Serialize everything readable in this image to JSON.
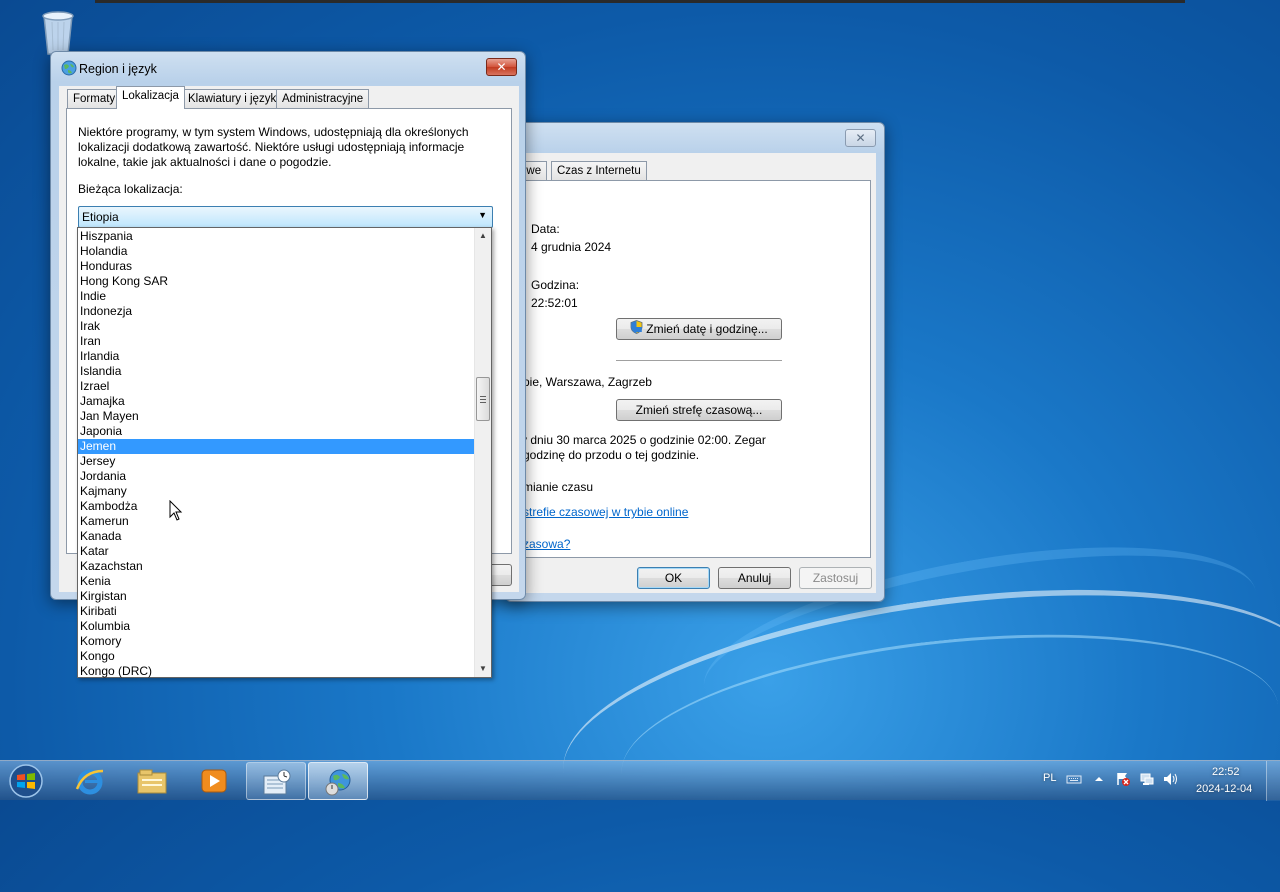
{
  "region_dialog": {
    "title": "Region i język",
    "tabs": [
      {
        "label": "Formaty"
      },
      {
        "label": "Lokalizacja"
      },
      {
        "label": "Klawiatury i języki"
      },
      {
        "label": "Administracyjne"
      }
    ],
    "description": "Niektóre programy, w tym system Windows, udostępniają dla określonych lokalizacji dodatkową zawartość. Niektóre usługi udostępniają informacje lokalne, takie jak aktualności i dane o pogodzie.",
    "current_location_label": "Bieżąca lokalizacja:",
    "current_location_value": "Etiopia",
    "dropdown_items": [
      "Hiszpania",
      "Holandia",
      "Honduras",
      "Hong Kong SAR",
      "Indie",
      "Indonezja",
      "Irak",
      "Iran",
      "Irlandia",
      "Islandia",
      "Izrael",
      "Jamajka",
      "Jan Mayen",
      "Japonia",
      "Jemen",
      "Jersey",
      "Jordania",
      "Kajmany",
      "Kambodża",
      "Kamerun",
      "Kanada",
      "Katar",
      "Kazachstan",
      "Kenia",
      "Kirgistan",
      "Kiribati",
      "Kolumbia",
      "Komory",
      "Kongo",
      "Kongo (DRC)"
    ],
    "highlighted_item": "Jemen"
  },
  "datetime_dialog": {
    "tabs": [
      {
        "label": "owe"
      },
      {
        "label": "Czas z Internetu"
      }
    ],
    "date_label": "Data:",
    "date_value": "4 grudnia 2024",
    "time_label": "Godzina:",
    "time_value": "22:52:01",
    "change_datetime_button": "Zmień datę i godzinę...",
    "timezone_text": "pie, Warszawa, Zagrzeb",
    "change_timezone_button": "Zmień strefę czasową...",
    "dst_text_line1": "v dniu 30 marca 2025 o godzinie 02:00. Zegar",
    "dst_text_line2": "godzinę do przodu o tej godzinie.",
    "notify_text": "mianie czasu",
    "online_link": "strefie czasowej w trybie online",
    "timezone_link": "zasowa?",
    "ok_button": "OK",
    "cancel_button": "Anuluj",
    "apply_button": "Zastosuj"
  },
  "taskbar": {
    "items": [
      {
        "icon": "internet-explorer-icon",
        "state": "pinned"
      },
      {
        "icon": "file-explorer-icon",
        "state": "pinned"
      },
      {
        "icon": "media-player-icon",
        "state": "pinned"
      },
      {
        "icon": "control-panel-icon",
        "state": "open"
      },
      {
        "icon": "region-globe-icon",
        "state": "active"
      }
    ],
    "language": "PL",
    "clock_time": "22:52",
    "clock_date": "2024-12-04"
  },
  "colors": {
    "selection": "#3399ff",
    "close_button": "#c13b20",
    "link": "#0066cc"
  }
}
